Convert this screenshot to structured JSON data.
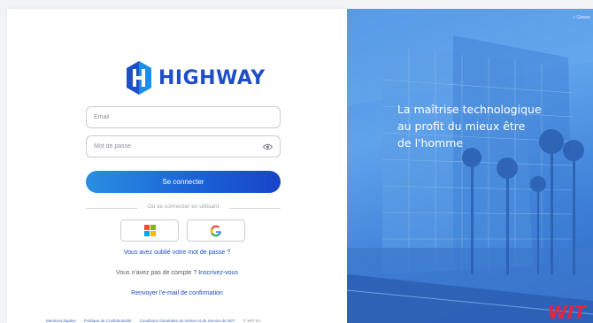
{
  "brand": {
    "name": "HIGHWAY"
  },
  "login": {
    "email_placeholder": "Email",
    "password_placeholder": "Mot de passe",
    "submit_label": "Se connecter",
    "divider_text": "Ou se connecter en utilisant",
    "sso": [
      "microsoft-icon",
      "google-icon"
    ],
    "forgot_password": "Vous avez oublié votre mot de passe ?",
    "no_account_text": "Vous n'avez pas de compte ?",
    "signup_link": "Inscrivez-vous",
    "resend_confirmation": "Renvoyer l'e-mail de confirmation"
  },
  "footer": {
    "legal": "Mentions légales",
    "privacy": "Politique de Confidentialité",
    "terms": "Conditions Générales de Ventes et de Service de WIT",
    "copyright": "© WIT SA"
  },
  "hero": {
    "corner_text": "« Glisser",
    "tagline_line1": "La maîtrise technologique",
    "tagline_line2": "au profit du mieux être",
    "tagline_line3": "de l'homme",
    "partner_logo": "WIT"
  },
  "colors": {
    "primary": "#1b4ec0",
    "button_start": "#2a8fe0",
    "button_end": "#1844c7",
    "hero_overlay": "#4a8fe0",
    "accent_red": "#e8243c"
  }
}
